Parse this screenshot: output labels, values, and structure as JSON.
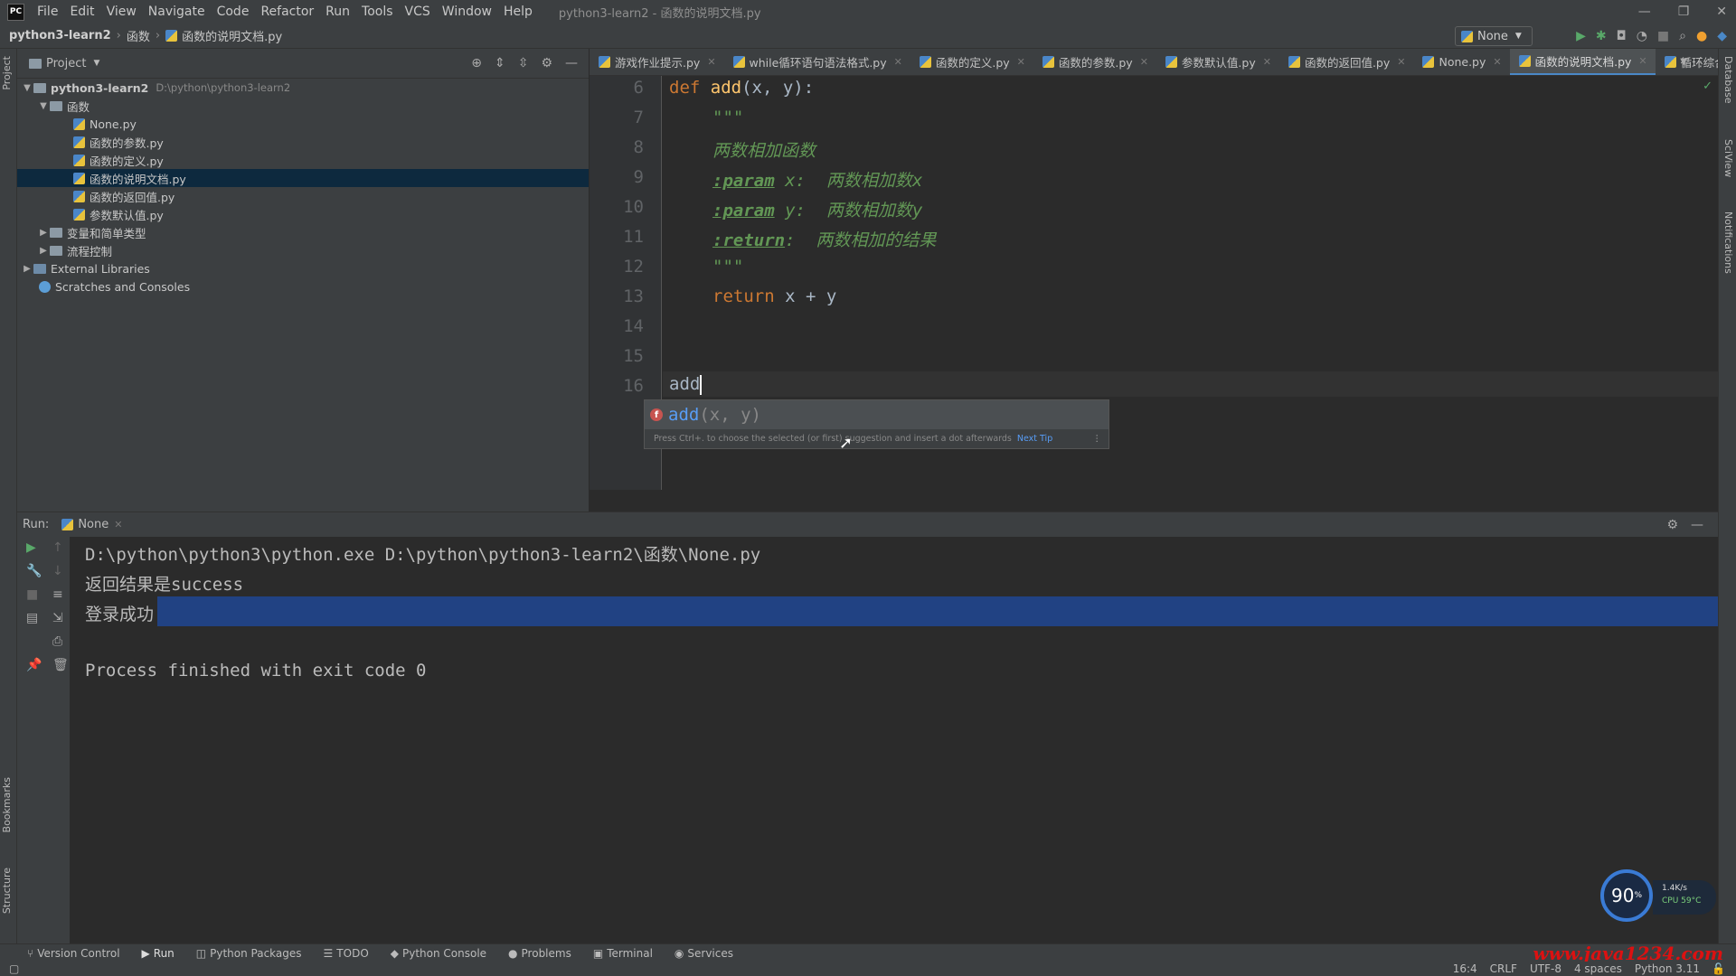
{
  "window": {
    "title": "python3-learn2 - 函数的说明文档.py",
    "app_logo": "PC"
  },
  "menu": [
    "File",
    "Edit",
    "View",
    "Navigate",
    "Code",
    "Refactor",
    "Run",
    "Tools",
    "VCS",
    "Window",
    "Help"
  ],
  "breadcrumb": {
    "project": "python3-learn2",
    "folder": "函数",
    "file": "函数的说明文档.py"
  },
  "run_config": {
    "name": "None"
  },
  "project_panel": {
    "header": "Project",
    "tree": [
      {
        "label": "python3-learn2",
        "path": "D:\\python\\python3-learn2",
        "level": 0,
        "type": "root",
        "expanded": true
      },
      {
        "label": "函数",
        "level": 1,
        "type": "folder",
        "expanded": true
      },
      {
        "label": "None.py",
        "level": 2,
        "type": "file"
      },
      {
        "label": "函数的参数.py",
        "level": 2,
        "type": "file"
      },
      {
        "label": "函数的定义.py",
        "level": 2,
        "type": "file"
      },
      {
        "label": "函数的说明文档.py",
        "level": 2,
        "type": "file",
        "selected": true
      },
      {
        "label": "函数的返回值.py",
        "level": 2,
        "type": "file"
      },
      {
        "label": "参数默认值.py",
        "level": 2,
        "type": "file"
      },
      {
        "label": "变量和简单类型",
        "level": 1,
        "type": "folder",
        "expanded": false
      },
      {
        "label": "流程控制",
        "level": 1,
        "type": "folder",
        "expanded": false
      },
      {
        "label": "External Libraries",
        "level": 0,
        "type": "library",
        "expanded": false
      },
      {
        "label": "Scratches and Consoles",
        "level": 0,
        "type": "scratch"
      }
    ]
  },
  "editor_tabs": [
    {
      "label": "游戏作业提示.py"
    },
    {
      "label": "while循环语句语法格式.py"
    },
    {
      "label": "函数的定义.py"
    },
    {
      "label": "函数的参数.py"
    },
    {
      "label": "参数默认值.py"
    },
    {
      "label": "函数的返回值.py"
    },
    {
      "label": "None.py"
    },
    {
      "label": "函数的说明文档.py",
      "active": true
    },
    {
      "label": "循环综合案"
    }
  ],
  "code": {
    "line_numbers": [
      "6",
      "7",
      "8",
      "9",
      "10",
      "11",
      "12",
      "13",
      "14",
      "15",
      "16"
    ],
    "def_kw": "def",
    "func_name": "add",
    "signature": "(x, y):",
    "docq1": "\"\"\"",
    "doc_desc": "两数相加函数",
    "param1_tag": ":param",
    "param1_rest": " x:  两数相加数x",
    "param2_tag": ":param",
    "param2_rest": " y:  两数相加数y",
    "return_tag": ":return",
    "return_rest": ":  两数相加的结果",
    "docq2": "\"\"\"",
    "return_kw": "return",
    "return_expr": " x + y",
    "typed": "add"
  },
  "completion": {
    "item": "add",
    "item_args": "(x, y)",
    "hint": "Press Ctrl+. to choose the selected (or first) suggestion and insert a dot afterwards",
    "next_tip": "Next Tip"
  },
  "run_panel": {
    "label": "Run:",
    "tab": "None",
    "lines": [
      "D:\\python\\python3\\python.exe D:\\python\\python3-learn2\\函数\\None.py",
      "返回结果是success",
      "登录成功",
      "",
      "Process finished with exit code 0"
    ]
  },
  "widget": {
    "percent": "90",
    "unit": "%",
    "net": "1.4K/s",
    "cpu": "CPU 59°C"
  },
  "tool_windows": [
    "Version Control",
    "Run",
    "Python Packages",
    "TODO",
    "Python Console",
    "Problems",
    "Terminal",
    "Services"
  ],
  "left_strip": [
    "Project",
    "Bookmarks",
    "Structure"
  ],
  "right_strip": [
    "Database",
    "SciView",
    "Notifications"
  ],
  "status": {
    "position": "16:4",
    "line_sep": "CRLF",
    "encoding": "UTF-8",
    "indent": "4 spaces",
    "interpreter": "Python 3.11"
  },
  "watermark": "www.java1234.com",
  "colors": {
    "keyword": "#cc7832",
    "function": "#ffc66d",
    "docstring": "#629755",
    "selection": "#214283",
    "accent": "#4a88c7"
  }
}
